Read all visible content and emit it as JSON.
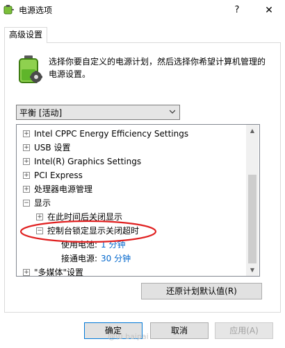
{
  "window": {
    "title": "电源选项",
    "help_label": "?",
    "close_label": "✕"
  },
  "tabs": [
    {
      "label": "高级设置"
    }
  ],
  "description": "选择你要自定义的电源计划，然后选择你希望计算机管理的电源设置。",
  "plan": {
    "selected": "平衡 [活动]"
  },
  "tree": {
    "items": [
      {
        "label": "Intel CPPC Energy Efficiency Settings",
        "expander": "+"
      },
      {
        "label": "USB 设置",
        "expander": "+"
      },
      {
        "label": "Intel(R) Graphics Settings",
        "expander": "+"
      },
      {
        "label": "PCI Express",
        "expander": "+"
      },
      {
        "label": "处理器电源管理",
        "expander": "+"
      },
      {
        "label": "显示",
        "expander": "−"
      },
      {
        "label": "在此时间后关闭显示",
        "expander": "+"
      },
      {
        "label": "控制台锁定显示关闭超时",
        "expander": "−"
      },
      {
        "label": "\"多媒体\"设置",
        "expander": "+"
      }
    ],
    "battery_setting": {
      "label": "使用电池:",
      "value": "1 分钟"
    },
    "plugged_setting": {
      "label": "接通电源:",
      "value": "30 分钟"
    }
  },
  "buttons": {
    "restore": "还原计划默认值(R)",
    "ok": "确定",
    "cancel": "取消",
    "apply": "应用(A)"
  },
  "watermark": "@\\u baipai",
  "colors": {
    "accent": "#0078d7",
    "annotation": "#e02020",
    "link": "#0066cc"
  }
}
